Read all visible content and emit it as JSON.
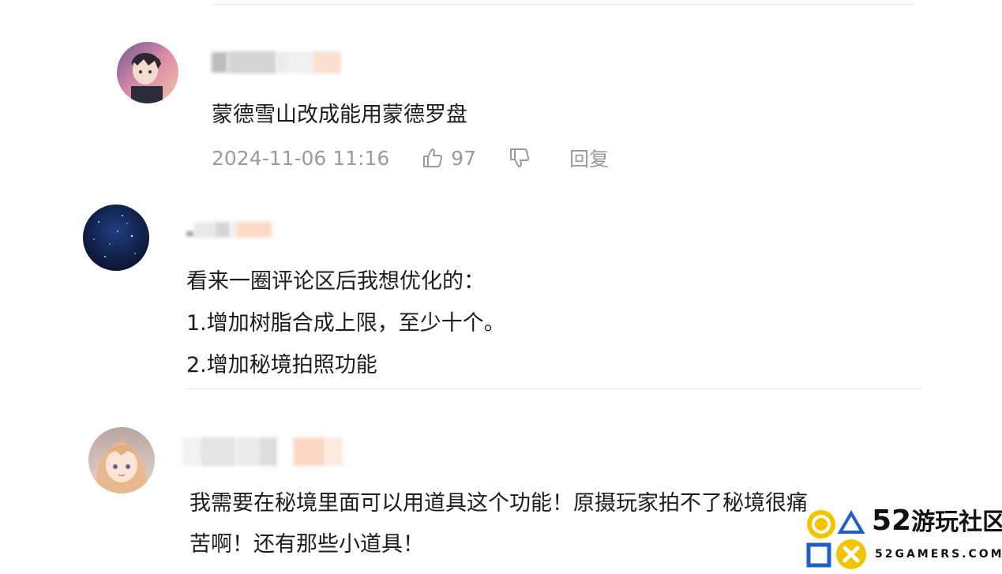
{
  "comments": [
    {
      "text_lines": [
        "蒙德雪山改成能用蒙德罗盘"
      ],
      "timestamp": "2024-11-06 11:16",
      "likes": "97",
      "reply_label": "回复"
    },
    {
      "text_lines": [
        "看来一圈评论区后我想优化的：",
        "1.增加树脂合成上限，至少十个。",
        "2.增加秘境拍照功能"
      ]
    },
    {
      "text_lines": [
        "我需要在秘境里面可以用道具这个功能！原摄玩家拍不了秘境很痛",
        "苦啊！还有那些小道具！"
      ]
    }
  ],
  "watermark": {
    "title_num": "52",
    "title_text": "游玩社区",
    "subtitle": "52GAMERS.COM"
  }
}
